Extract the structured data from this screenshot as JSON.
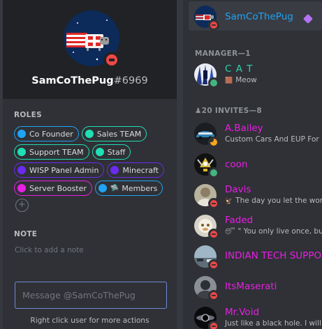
{
  "profile": {
    "username": "SamCoThePug",
    "discriminator": "#6969",
    "status": "dnd",
    "roles_title": "ROLES",
    "roles": [
      {
        "name": "Co Founder",
        "color": "#1fa3f5",
        "icon": null
      },
      {
        "name": "Sales TEAM",
        "color": "#1fdfb4",
        "icon": null
      },
      {
        "name": "Support TEAM",
        "color": "#1fdfb4",
        "icon": null
      },
      {
        "name": "Staff",
        "color": "#1fdfb4",
        "icon": null
      },
      {
        "name": "WISP Panel Admin",
        "color": "#6b2bf0",
        "icon": null
      },
      {
        "name": "Minecraft",
        "color": "#6b2bf0",
        "icon": null
      },
      {
        "name": "Server Booster",
        "color": "#e91fe4",
        "icon": null
      },
      {
        "name": "Members",
        "color": "#1fa3f5",
        "icon": "🛸"
      }
    ],
    "add_role_symbol": "+",
    "note_title": "NOTE",
    "note_placeholder": "Click to add a note",
    "message_placeholder": "Message @SamCoThePug",
    "footer_hint": "Right click user for more actions"
  },
  "member_list": {
    "selected": {
      "name": "SamCoThePug",
      "name_color": "#1fa3f5",
      "status": "dnd",
      "owner_icon": "owner-gem-icon"
    },
    "groups": [
      {
        "header": "MANAGER—1",
        "header_icon": null,
        "members": [
          {
            "name": "C A T",
            "name_color": "#2ed3a6",
            "status": "online",
            "activity": "Meow",
            "activity_emoji": "🟫"
          }
        ]
      },
      {
        "header": "20 INVITES—8",
        "header_icon": "♟",
        "members": [
          {
            "name": "A.Bailey",
            "name_color": "#e91fe4",
            "status": "idle",
            "activity": "Custom Cars And EUP For F",
            "activity_emoji": null
          },
          {
            "name": "coon",
            "name_color": "#e91fe4",
            "status": "online",
            "activity": null,
            "activity_emoji": null
          },
          {
            "name": "Davis",
            "name_color": "#e91fe4",
            "status": "dnd",
            "activity": "The day you let the world",
            "activity_emoji": "🦅"
          },
          {
            "name": "Faded",
            "name_color": "#e91fe4",
            "status": "dnd",
            "activity": "\" You only live once, bu",
            "activity_emoji": "😴"
          },
          {
            "name": "INDIAN TECH SUPPO",
            "name_color": "#e91fe4",
            "status": "dnd",
            "activity": null,
            "activity_emoji": null
          },
          {
            "name": "ItsMaserati",
            "name_color": "#e91fe4",
            "status": "dnd",
            "activity": null,
            "activity_emoji": null
          },
          {
            "name": "Mr.Void",
            "name_color": "#e91fe4",
            "status": "dnd",
            "activity": "Just like a black hole. I will a",
            "activity_emoji": null
          }
        ]
      }
    ]
  },
  "colors": {
    "accent_blurple": "#7289da",
    "dnd": "#f04747",
    "online": "#43b581",
    "idle": "#faa61a"
  }
}
